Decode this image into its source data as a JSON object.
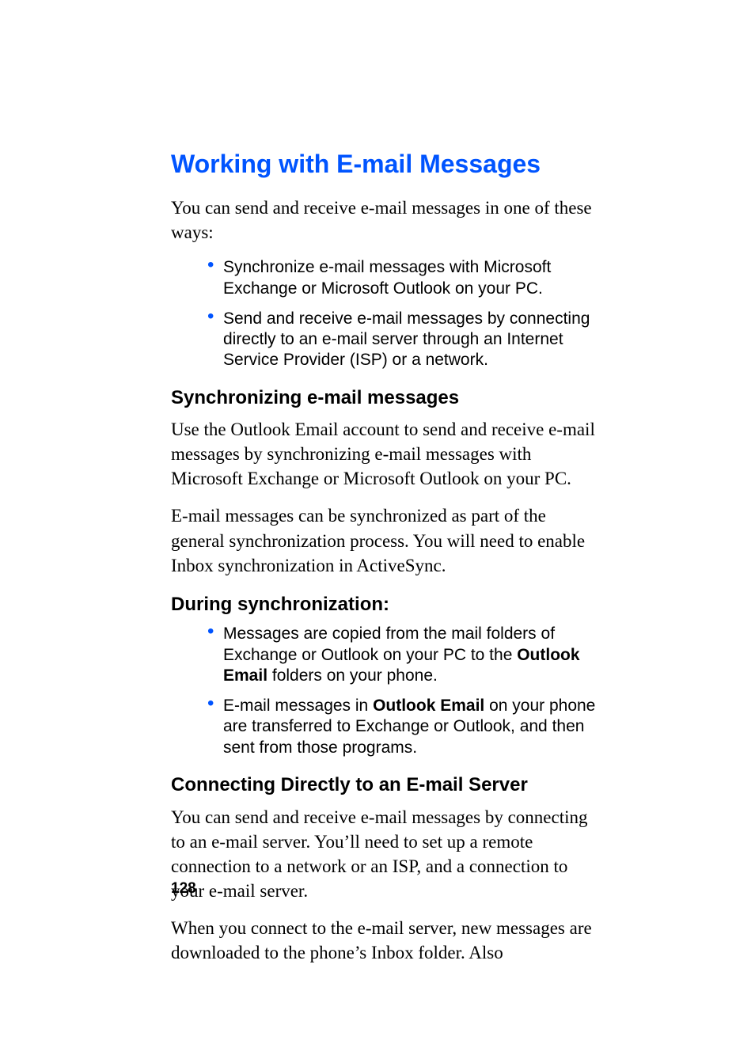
{
  "title": "Working with E-mail Messages",
  "intro": "You can send and receive e-mail messages in one of these ways:",
  "intro_bullets": [
    "Synchronize e-mail messages with Microsoft Exchange or Microsoft Outlook on your PC.",
    "Send and receive e-mail messages by connecting directly to an e-mail server through an Internet Service Provider (ISP) or a network."
  ],
  "sync_head": "Synchronizing e-mail messages",
  "sync_p1": "Use the Outlook Email account to send and receive e-mail messages by synchronizing e-mail messages with Microsoft Exchange or Microsoft Outlook on your PC.",
  "sync_p2": "E-mail messages can be synchronized as part of the general synchronization process. You will need to enable Inbox synchronization in ActiveSync.",
  "during_head": "During synchronization:",
  "during_bullets": {
    "b1_pre": "Messages are copied from the mail folders of Exchange or Outlook on your PC to the ",
    "b1_bold": "Outlook Email",
    "b1_post": " folders on your phone.",
    "b2_pre": "E-mail messages in ",
    "b2_bold": "Outlook Email",
    "b2_post": " on your phone are transferred to Exchange or Outlook, and then sent from those programs."
  },
  "connect_head": "Connecting Directly to an E-mail Server",
  "connect_p1": "You can send and receive e-mail messages by connecting to an e-mail server. You’ll need to set up a remote connection to a network or an ISP, and a connection to your e-mail server.",
  "connect_p2": "When you connect to the e-mail server, new messages are downloaded to the phone’s Inbox folder. Also",
  "page_number": "128"
}
